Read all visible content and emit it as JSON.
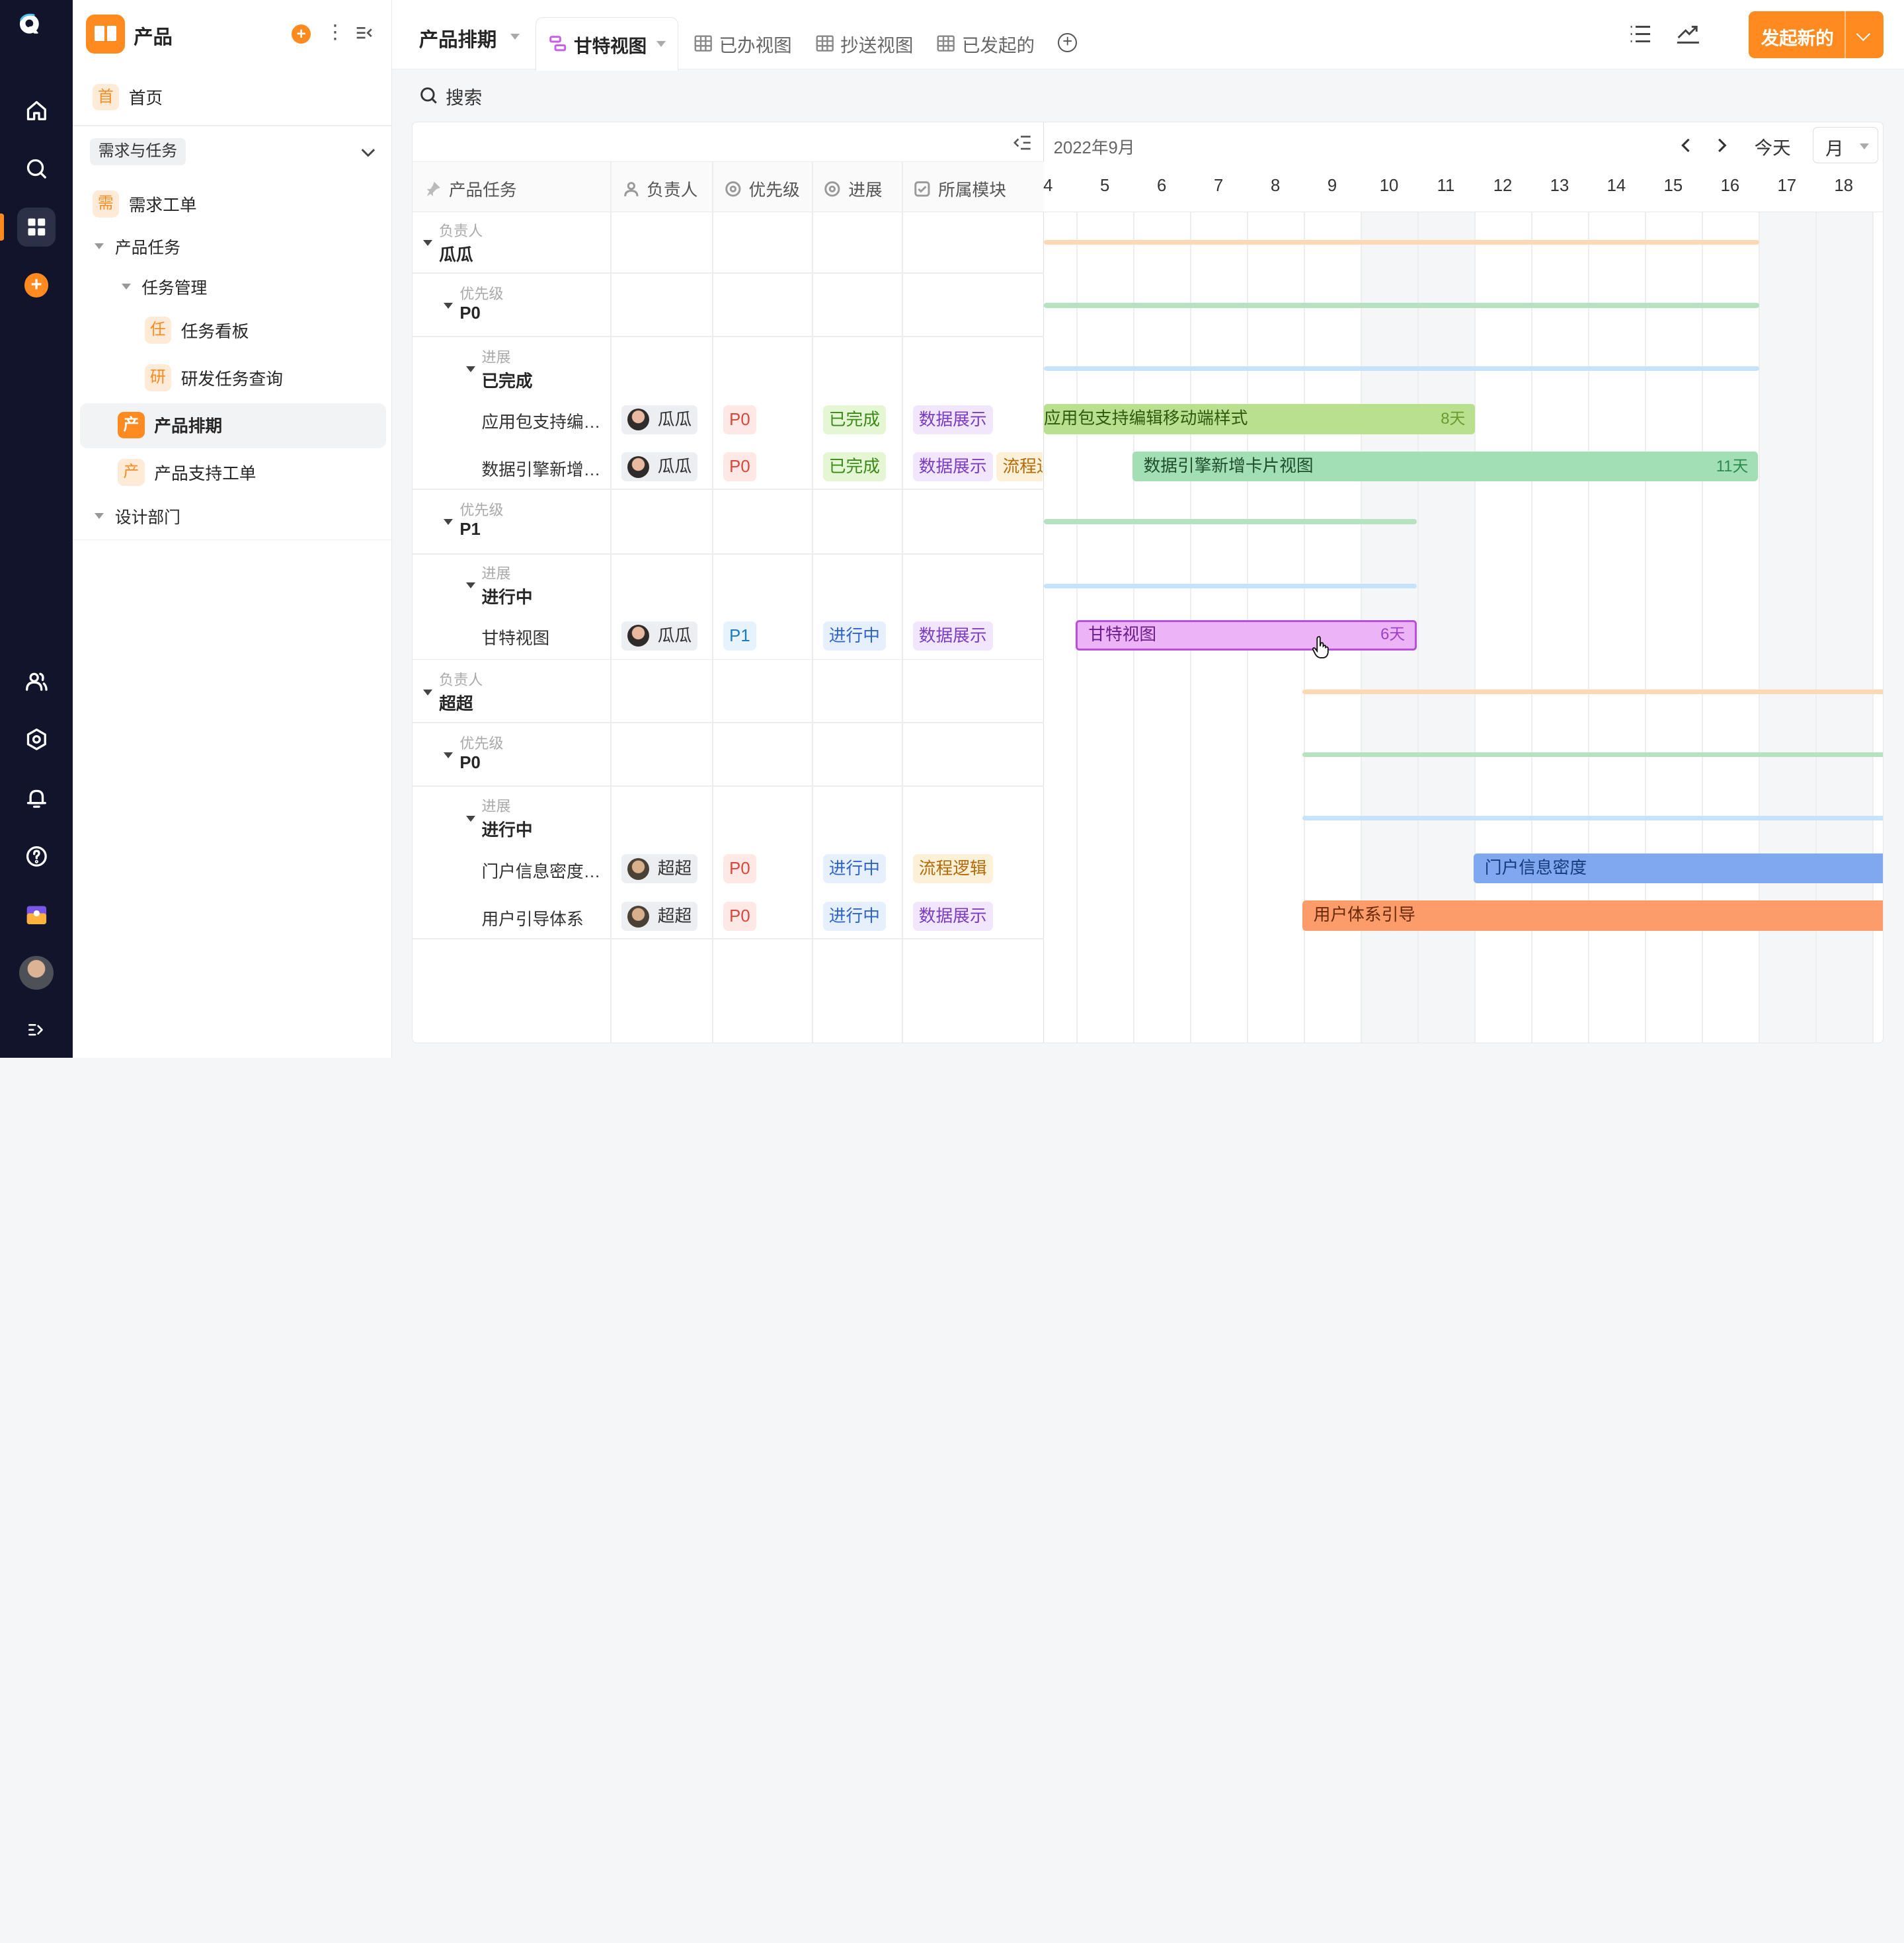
{
  "app": {
    "title": "产品"
  },
  "sidebar": {
    "home": {
      "tag": "首",
      "label": "首页"
    },
    "group": "需求与任务",
    "items": [
      {
        "tag": "需",
        "label": "需求工单"
      },
      {
        "label": "产品任务"
      },
      {
        "label": "任务管理"
      },
      {
        "tag": "任",
        "label": "任务看板"
      },
      {
        "tag": "研",
        "label": "研发任务查询"
      },
      {
        "tag": "产",
        "label": "产品排期"
      },
      {
        "tag": "产",
        "label": "产品支持工单"
      },
      {
        "label": "设计部门"
      }
    ]
  },
  "header": {
    "project": "产品排期",
    "tabs": [
      {
        "label": "甘特视图",
        "active": true
      },
      {
        "label": "已办视图"
      },
      {
        "label": "抄送视图"
      },
      {
        "label": "已发起的"
      }
    ],
    "launch": "发起新的",
    "accent": "#ff8a1f"
  },
  "search": {
    "placeholder": "搜索"
  },
  "grid": {
    "columns": [
      "产品任务",
      "负责人",
      "优先级",
      "进展",
      "所属模块"
    ],
    "rows": [
      {
        "kind": "group",
        "key": "负责人",
        "value": "瓜瓜"
      },
      {
        "kind": "group",
        "key": "优先级",
        "value": "P0"
      },
      {
        "kind": "group",
        "key": "进展",
        "value": "已完成"
      },
      {
        "kind": "task",
        "name": "应用包支持编辑移动端样式",
        "owner": "瓜瓜",
        "priority": "P0",
        "status": "已完成",
        "modules": [
          "数据展示"
        ]
      },
      {
        "kind": "task",
        "name": "数据引擎新增卡片视图",
        "owner": "瓜瓜",
        "priority": "P0",
        "status": "已完成",
        "modules": [
          "数据展示",
          "流程逻辑"
        ]
      },
      {
        "kind": "group",
        "key": "优先级",
        "value": "P1"
      },
      {
        "kind": "group",
        "key": "进展",
        "value": "进行中"
      },
      {
        "kind": "task",
        "name": "甘特视图",
        "owner": "瓜瓜",
        "priority": "P1",
        "status": "进行中",
        "modules": [
          "数据展示"
        ]
      },
      {
        "kind": "group",
        "key": "负责人",
        "value": "超超"
      },
      {
        "kind": "group",
        "key": "优先级",
        "value": "P0"
      },
      {
        "kind": "group",
        "key": "进展",
        "value": "进行中"
      },
      {
        "kind": "task",
        "name": "门户信息密度调整",
        "owner": "超超",
        "priority": "P0",
        "status": "进行中",
        "modules": [
          "流程逻辑"
        ]
      },
      {
        "kind": "task",
        "name": "用户引导体系",
        "owner": "超超",
        "priority": "P0",
        "status": "进行中",
        "modules": [
          "数据展示"
        ]
      }
    ]
  },
  "gantt": {
    "month": "2022年9月",
    "today": "今天",
    "scale": "月",
    "days": [
      "4",
      "5",
      "6",
      "7",
      "8",
      "9",
      "10",
      "11",
      "12",
      "13",
      "14",
      "15",
      "16",
      "17",
      "18"
    ],
    "bars": [
      {
        "label": "应用包支持编辑移动端样式",
        "duration": "8天",
        "color": "#b9e08e"
      },
      {
        "label": "数据引擎新增卡片视图",
        "duration": "11天",
        "color": "#a3dfb5"
      },
      {
        "label": "甘特视图",
        "duration": "6天",
        "color": "#ecb4f7"
      },
      {
        "label": "门户信息密度",
        "duration": "",
        "color": "#7fa8f0"
      },
      {
        "label": "用户体系引导",
        "duration": "",
        "color": "#fb9c6a"
      }
    ]
  }
}
